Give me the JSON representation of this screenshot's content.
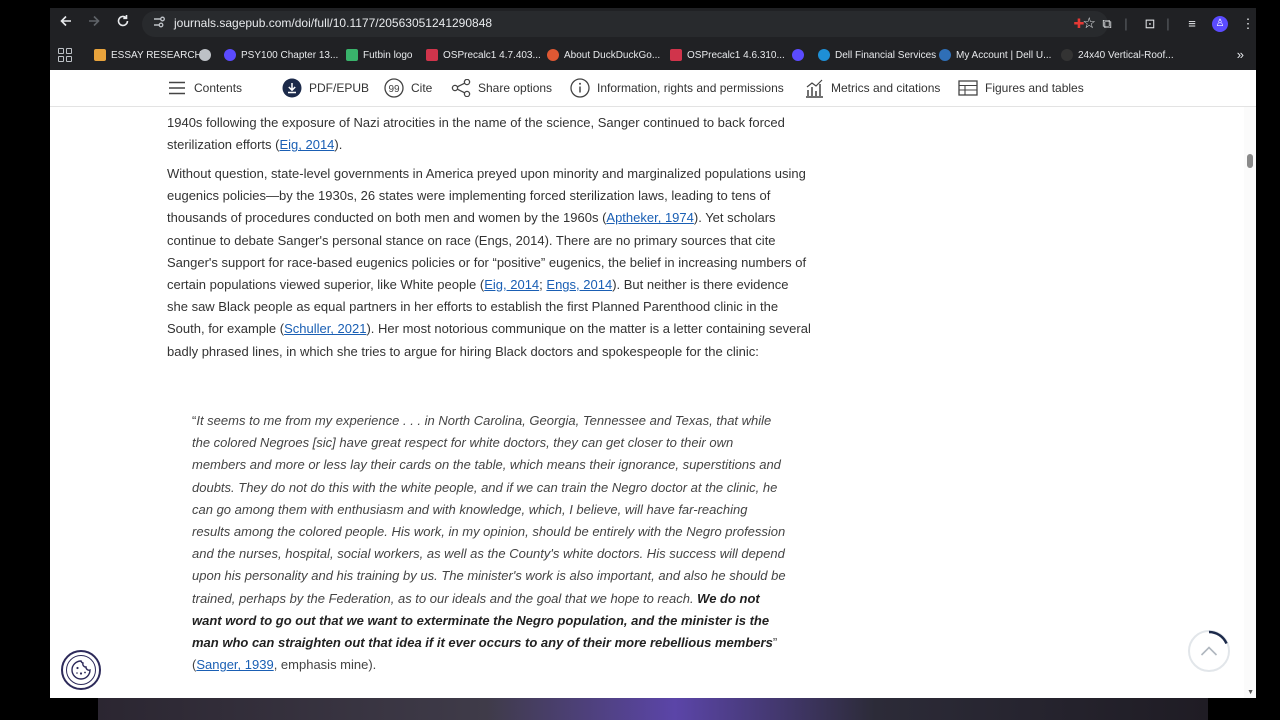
{
  "browser": {
    "url": "journals.sagepub.com/doi/full/10.1177/20563051241290848",
    "bookmarks": [
      {
        "label": "ESSAY RESEARCH",
        "color": "#e8a33c"
      },
      {
        "label": "",
        "color": "#bdc1c6"
      },
      {
        "label": "PSY100 Chapter 13...",
        "color": "#5b4bff"
      },
      {
        "label": "Futbin logo",
        "color": "#39b36b"
      },
      {
        "label": "OSPrecalc1 4.7.403...",
        "color": "#d0344b"
      },
      {
        "label": "About DuckDuckGo...",
        "color": "#de5833"
      },
      {
        "label": "OSPrecalc1 4.6.310...",
        "color": "#d0344b"
      },
      {
        "label": "",
        "color": "#5b4bff"
      },
      {
        "label": "Dell Financial Services",
        "color": "#1e8fd6"
      },
      {
        "label": "My Account | Dell U...",
        "color": "#2f6fb7"
      },
      {
        "label": "24x40 Vertical-Roof...",
        "color": "#333333"
      }
    ]
  },
  "toolbar": {
    "contents": "Contents",
    "pdf": "PDF/EPUB",
    "cite": "Cite",
    "share": "Share options",
    "info": "Information, rights and permissions",
    "metrics": "Metrics and citations",
    "figures": "Figures and tables"
  },
  "article": {
    "p1_text": "1940s following the exposure of Nazi atrocities in the name of the science, Sanger continued to back forced sterilization efforts (",
    "p1_cite": "Eig, 2014",
    "p1_end": ").",
    "p2_a": "Without question, state-level governments in America preyed upon minority and marginalized populations using eugenics policies—by the 1930s, 26 states were implementing forced sterilization laws, leading to tens of thousands of procedures conducted on both men and women by the 1960s (",
    "p2_cite1": "Aptheker, 1974",
    "p2_b": "). Yet scholars continue to debate Sanger's personal stance on race (Engs, 2014). There are no primary sources that cite Sanger's support for race-based eugenics policies or for “positive” eugenics, the belief in increasing numbers of certain populations viewed superior, like White people (",
    "p2_cite2": "Eig, 2014",
    "p2_sep": "; ",
    "p2_cite3": "Engs, 2014",
    "p2_c": "). But neither is there evidence she saw Black people as equal partners in her efforts to establish the first Planned Parenthood clinic in the South, for example (",
    "p2_cite4": "Schuller, 2021",
    "p2_d": "). Her most notorious communique on the matter is a letter containing several badly phrased lines, in which she tries to argue for hiring Black doctors and spokespeople for the clinic:",
    "quote_open": "“",
    "quote_text": "It seems to me from my experience . . . in North Carolina, Georgia, Tennessee and Texas, that while the colored Negroes [sic] have great respect for white doctors, they can get closer to their own members and more or less lay their cards on the table, which means their ignorance, superstitions and doubts. They do not do this with the white people, and if we can train the Negro doctor at the clinic, he can go among them with enthusiasm and with knowledge, which, I believe, will have far-reaching results among the colored people. His work, in my opinion, should be entirely with the Negro profession and the nurses, hospital, social workers, as well as the County's white doctors. His success will depend upon his personality and his training by us. The minister's work is also important, and also he should be trained, perhaps by the Federation, as to our ideals and the goal that we hope to reach. ",
    "quote_bold": "We do not want word to go out that we want to exterminate the Negro population, and the minister is the man who can straighten out that idea if it ever occurs to any of their more rebellious members",
    "quote_close": "” (",
    "quote_cite": "Sanger, 1939",
    "quote_end": ", emphasis mine)."
  },
  "colors": {
    "link": "#1a5fb4",
    "chrome_bg": "#202124",
    "page_bg": "#ffffff"
  },
  "icons": [
    "arrow-left-icon",
    "arrow-right-icon",
    "reload-icon",
    "site-info-icon",
    "star-icon",
    "apps-icon",
    "hamburger-icon",
    "download-icon",
    "quote-icon",
    "share-icon",
    "info-icon",
    "bar-chart-icon",
    "table-icon",
    "cookie-icon",
    "chevron-up-icon"
  ]
}
